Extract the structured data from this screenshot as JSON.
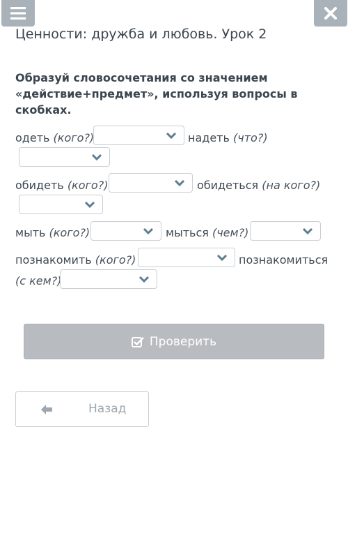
{
  "header": {
    "title": "Ценности: дружба и любовь. Урок 2",
    "menu_icon": "hamburger-menu-icon",
    "close_icon": "close-icon"
  },
  "task": {
    "instruction": "Образуй словосочетания со значением «действие+предмет», используя вопросы в скобках."
  },
  "items": [
    {
      "word": "одеть",
      "question": "(кого?)"
    },
    {
      "word": "надеть",
      "question": "(что?)"
    },
    {
      "word": "обидеть",
      "question": "(кого?)"
    },
    {
      "word": "обидеться",
      "question": "(на кого?)"
    },
    {
      "word": "мыть",
      "question": "(кого?)"
    },
    {
      "word": "мыться",
      "question": "(чем?)"
    },
    {
      "word": "познакомить",
      "question": "(кого?)"
    },
    {
      "word": "познакомиться",
      "question": "(с кем?)"
    }
  ],
  "buttons": {
    "check_label": "Проверить",
    "back_label": "Назад"
  },
  "colors": {
    "header_button": "#aab2b9",
    "check_button": "#b8bcc0",
    "dropdown_chevron": "#5d7d90",
    "text": "#3b4650"
  }
}
